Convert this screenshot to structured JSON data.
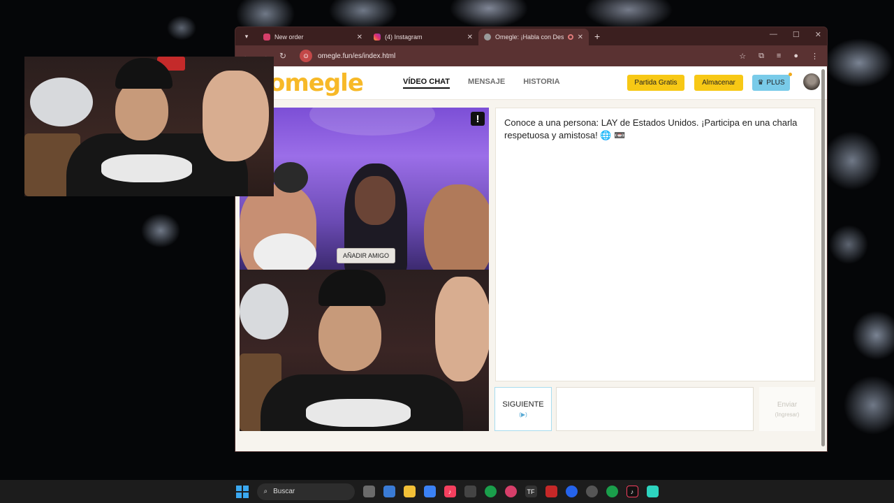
{
  "browser": {
    "tabs": [
      {
        "title": "New order",
        "favicon_color": "#d63f6a",
        "active": false
      },
      {
        "title": "(4) Instagram",
        "favicon_color": "#e1306c",
        "active": false
      },
      {
        "title": "Omegle: ¡Habla con Descon",
        "favicon_color": "#9a9a9a",
        "active": true
      }
    ],
    "url": "omegle.fun/es/index.html"
  },
  "site": {
    "logo": "omegle",
    "nav": [
      "VÍDEO CHAT",
      "MENSAJE",
      "HISTORIA"
    ],
    "buttons": {
      "free_game": "Partida Gratis",
      "store": "Almacenar",
      "plus": "PLUS",
      "plus_icon": "♛"
    }
  },
  "video": {
    "report_icon": "!",
    "add_friend": "AÑADIR AMIGO"
  },
  "chat": {
    "message": "Conoce a una persona: LAY de Estados Unidos. ¡Participa en una charla respetuosa y amistosa! 🌐 📼",
    "next_label": "SIGUIENTE",
    "next_hint": "(▶)",
    "send_label": "Enviar",
    "send_hint": "(Ingresar)"
  },
  "taskbar": {
    "search_placeholder": "Buscar"
  },
  "colors": {
    "accent_gold": "#f7c815",
    "logo_yellow": "#f7b928",
    "plus_blue": "#79cbe9",
    "browser_frame": "#3b1f1f"
  }
}
